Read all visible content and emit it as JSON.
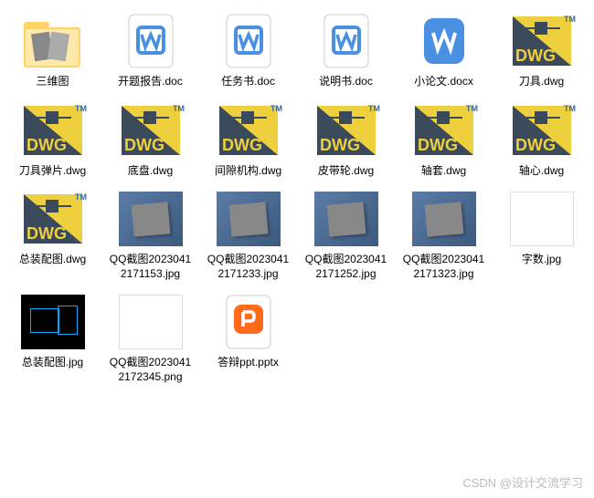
{
  "files": [
    {
      "name": "三维图",
      "type": "folder"
    },
    {
      "name": "开题报告.doc",
      "type": "doc"
    },
    {
      "name": "任务书.doc",
      "type": "doc"
    },
    {
      "name": "说明书.doc",
      "type": "doc"
    },
    {
      "name": "小论文.docx",
      "type": "docx"
    },
    {
      "name": "刀具.dwg",
      "type": "dwg"
    },
    {
      "name": "刀具弹片.dwg",
      "type": "dwg"
    },
    {
      "name": "底盘.dwg",
      "type": "dwg"
    },
    {
      "name": "间隙机构.dwg",
      "type": "dwg"
    },
    {
      "name": "皮带轮.dwg",
      "type": "dwg"
    },
    {
      "name": "轴套.dwg",
      "type": "dwg"
    },
    {
      "name": "轴心.dwg",
      "type": "dwg"
    },
    {
      "name": "总装配图.dwg",
      "type": "dwg"
    },
    {
      "name": "QQ截图20230412171153.jpg",
      "type": "thumb-3d"
    },
    {
      "name": "QQ截图20230412171233.jpg",
      "type": "thumb-3d"
    },
    {
      "name": "QQ截图20230412171252.jpg",
      "type": "thumb-3d"
    },
    {
      "name": "QQ截图20230412171323.jpg",
      "type": "thumb-3d"
    },
    {
      "name": "字数.jpg",
      "type": "thumb-doc"
    },
    {
      "name": "总装配图.jpg",
      "type": "thumb-dark"
    },
    {
      "name": "QQ截图20230412172345.png",
      "type": "thumb-parts"
    },
    {
      "name": "答辩ppt.pptx",
      "type": "pptx"
    }
  ],
  "watermark": "CSDN @设计交流学习"
}
